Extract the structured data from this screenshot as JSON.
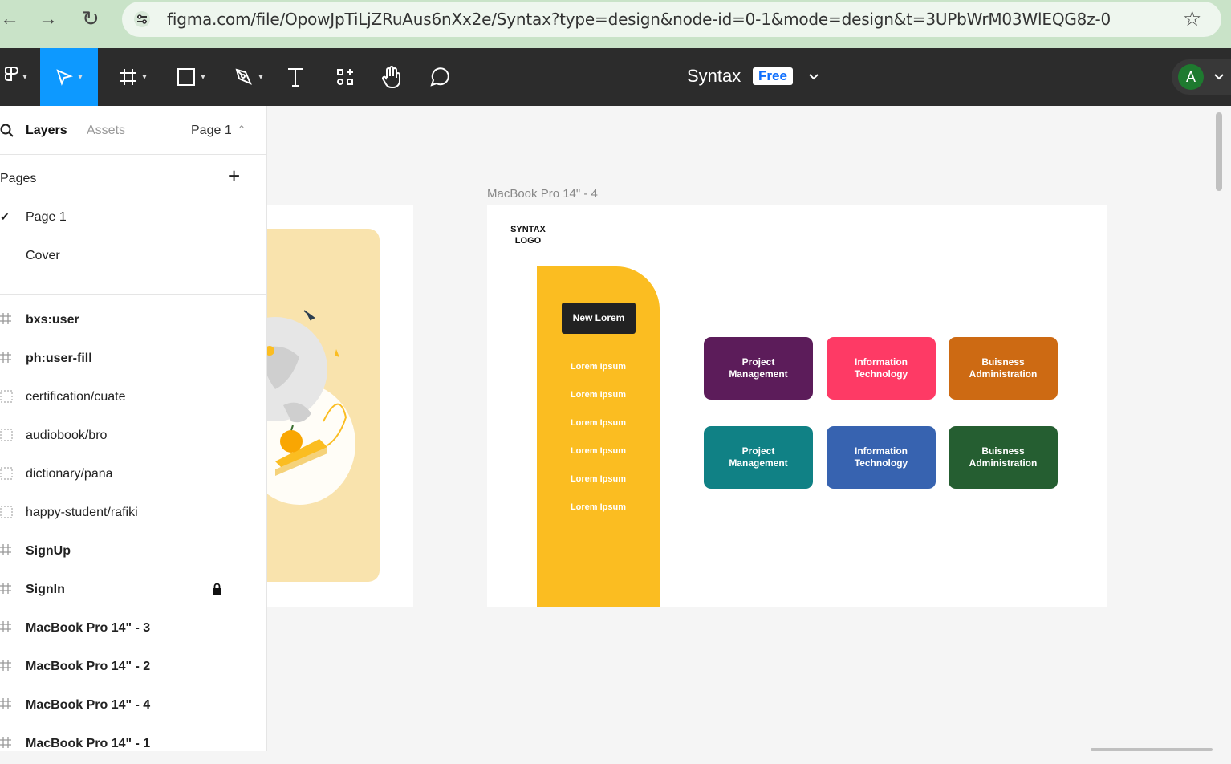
{
  "browser": {
    "back": "←",
    "forward": "→",
    "reload": "↻",
    "url": "figma.com/file/OpowJpTiLjZRuAus6nXx2e/Syntax?type=design&node-id=0-1&mode=design&t=3UPbWrM03WlEQG8z-0",
    "bookmark": "☆"
  },
  "toolbar": {
    "file_title": "Syntax",
    "plan_badge": "Free",
    "avatar_letter": "A"
  },
  "left_panel": {
    "tabs": [
      "Layers",
      "Assets"
    ],
    "current_page": "Page 1",
    "pages_header": "Pages",
    "pages": [
      {
        "label": "Page 1",
        "checked": true
      },
      {
        "label": "Cover",
        "checked": false
      }
    ],
    "layers": [
      {
        "name": "bxs:user",
        "bold": true,
        "icon": "frame-icon"
      },
      {
        "name": "ph:user-fill",
        "bold": true,
        "icon": "frame-icon"
      },
      {
        "name": "certification/cuate",
        "bold": false,
        "icon": "section-icon"
      },
      {
        "name": "audiobook/bro",
        "bold": false,
        "icon": "section-icon"
      },
      {
        "name": "dictionary/pana",
        "bold": false,
        "icon": "section-icon"
      },
      {
        "name": "happy-student/rafiki",
        "bold": false,
        "icon": "section-icon"
      },
      {
        "name": "SignUp",
        "bold": true,
        "icon": "frame-icon"
      },
      {
        "name": "SignIn",
        "bold": true,
        "icon": "frame-icon",
        "locked": true
      },
      {
        "name": "MacBook Pro 14\" - 3",
        "bold": true,
        "icon": "frame-icon"
      },
      {
        "name": "MacBook Pro 14\" - 2",
        "bold": true,
        "icon": "frame-icon"
      },
      {
        "name": "MacBook Pro 14\" - 4",
        "bold": true,
        "icon": "frame-icon"
      },
      {
        "name": "MacBook Pro 14\" - 1",
        "bold": true,
        "icon": "frame-icon"
      }
    ]
  },
  "canvas": {
    "frame_label": "MacBook Pro 14\" - 4",
    "logo": "SYNTAX LOGO",
    "new_button": "New Lorem",
    "menu_items": [
      "Lorem Ipsum",
      "Lorem Ipsum",
      "Lorem Ipsum",
      "Lorem Ipsum",
      "Lorem Ipsum",
      "Lorem Ipsum"
    ],
    "cards": [
      {
        "line1": "Project",
        "line2": "Management",
        "color": "#5c1c5a"
      },
      {
        "line1": "Information",
        "line2": "Technology",
        "color": "#fe3a65"
      },
      {
        "line1": "Buisness",
        "line2": "Administration",
        "color": "#cd6a13"
      },
      {
        "line1": "Project",
        "line2": "Management",
        "color": "#108185"
      },
      {
        "line1": "Information",
        "line2": "Technology",
        "color": "#3763b0"
      },
      {
        "line1": "Buisness",
        "line2": "Administration",
        "color": "#255e31"
      }
    ]
  },
  "colors": {
    "accent": "#0d99ff",
    "toolbar_bg": "#2c2c2c",
    "sidebar_yellow": "#fbbd21"
  }
}
